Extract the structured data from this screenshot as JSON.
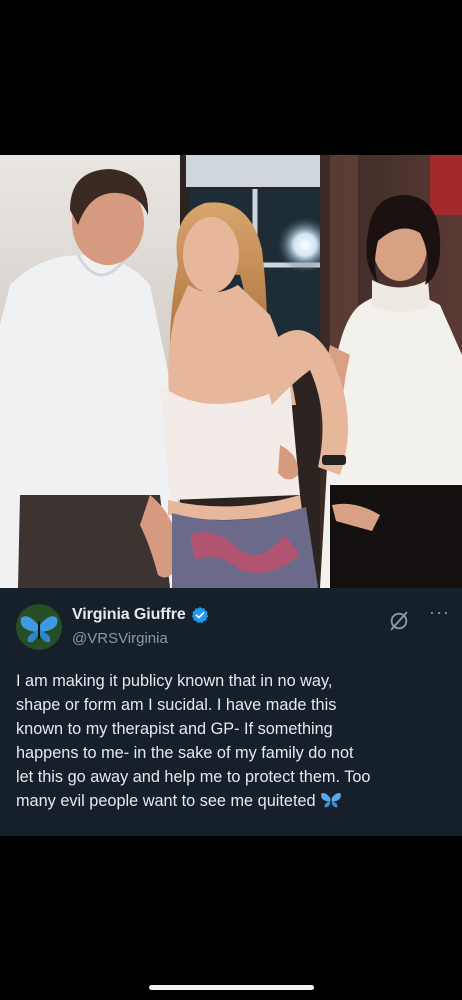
{
  "tweet": {
    "display_name": "Virginia Giuffre",
    "handle": "@VRSVirginia",
    "verified": true,
    "text": "I am making it publicy known that in no way,\nshape or form am I sucidal. I have made this\nknown to my therapist and GP- If something\nhappens to me- in the sake of my family do not\nlet this go away and help me to protect them. Too\nmany evil people want to see me quiteted",
    "emoji": "butterfly-icon",
    "avatar_icon": "butterfly-icon"
  },
  "icons": {
    "verified": "verified-badge-icon",
    "grok": "grok-icon",
    "more": "more-icon"
  },
  "more_glyph": "···",
  "colors": {
    "page_background": "#000000",
    "tweet_background": "#15202b",
    "text_primary": "#e7e9ea",
    "text_secondary": "#8b98a5",
    "verified_blue": "#1d9bf0",
    "butterfly_blue": "#5aa9e6"
  }
}
